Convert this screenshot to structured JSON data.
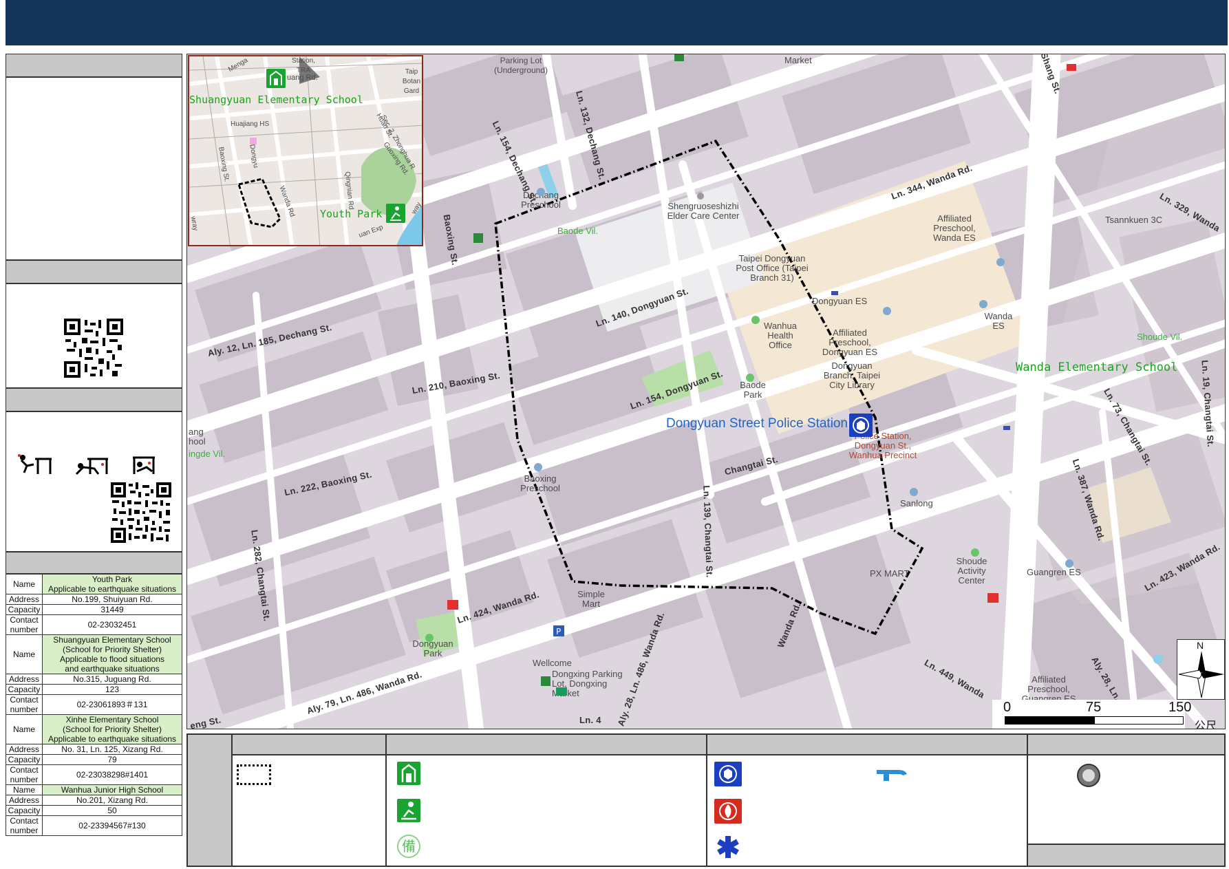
{
  "map": {
    "highlight_label": "Dongyuan Street Police Station",
    "green_labels": [
      "Shuangyuan Elementary School",
      "Youth Park",
      "Wanda Elementary School"
    ],
    "villages": [
      "Baode Vil.",
      "Shoude Vil.",
      "ingde Vil."
    ],
    "places": [
      "Market",
      "Parking Lot (Underground)",
      "Dechang Preschool",
      "Shengruoseshizhi Elder Care Center",
      "Affiliated Preschool, Wanda ES",
      "Tsannkuen 3C",
      "Taipei Dongyuan Post Office (Taipei Branch 31)",
      "Dongyuan ES",
      "Wanda ES",
      "Wanhua Health Office",
      "Affiliated Preschool, Dongyuan ES",
      "Dongyuan Branch, Taipei City Library",
      "Baode Park",
      "Police Station, Dongyuan St., Wanhua Precinct",
      "Baoxing Preschool",
      "Sanlong",
      "PX MART",
      "Shoude Activity Center",
      "Guangren ES",
      "Simple Mart",
      "Dongyuan Park",
      "Wellcome",
      "Dongxing Parking Lot, Dongxing Market",
      "Affiliated Preschool, Guangren ES",
      "ang hool"
    ],
    "roads": [
      "Ln. 132, Dechang St.",
      "Ln. 154, Dechang St.",
      "Ln. 344, Wanda Rd.",
      "Ln. 329, Wanda",
      "Baoxing St.",
      "Ln. 140, Dongyuan St.",
      "Aly. 12, Ln. 185, Dechang St.",
      "Ln. 210, Baoxing St.",
      "Ln. 154, Dongyuan St.",
      "Ln. 222, Baoxing St.",
      "Changtai St.",
      "Ln. 139, Changtai St.",
      "Ln. 282, Changtai St.",
      "Ln. 424, Wanda Rd.",
      "Aly. 28, Ln. 486, Wanda Rd.",
      "Wanda Rd.",
      "Aly. 79, Ln. 486, Wanda Rd.",
      "Ln. 449, Wanda",
      "Ln. 423, Wanda Rd.",
      "Ln. 387, Wanda Rd.",
      "Ln. 73, Changtai St.",
      "Ln. 19, Changtai St.",
      "Aly. 28, Ln.",
      "Ln. 4",
      "eng St.",
      "Changtai St.",
      "Shang St."
    ],
    "inset": {
      "labels": [
        "Station, TRA",
        "uang Rd.",
        "Taip Botan Gard",
        "Shuangyuan Elementary School",
        "Huajiang HS",
        "Huan St.",
        "Sec. 2, Zhonghua R",
        "Guoxing Rd.",
        "Baoxing St.",
        "Dongyu",
        "Wanda Rd",
        "Qingnian Rd",
        "Youth Park",
        "uan Exp",
        "way",
        "Menga",
        "wray"
      ]
    },
    "scale": {
      "ticks": [
        "0",
        "75",
        "150"
      ],
      "unit": "公尺"
    },
    "north": "N"
  },
  "shelters": [
    {
      "name": "Youth Park\nApplicable to earthquake situations",
      "address": "No.199, Shuiyuan Rd.",
      "capacity": "31449",
      "contact": "02-23032451"
    },
    {
      "name": "Shuangyuan Elementary School\n(School for Priority Shelter)\nApplicable to flood situations\nand earthquake situations",
      "address": "No.315, Juguang Rd.",
      "capacity": "123",
      "contact": "02-23061893＃131"
    },
    {
      "name": "Xinhe Elementary School\n(School for Priority Shelter)\nApplicable to earthquake situations",
      "address": "No. 31, Ln. 125, Xizang Rd.",
      "capacity": "79",
      "contact": "02-23038298#1401"
    },
    {
      "name": "Wanhua Junior High School",
      "address": "No.201, Xizang Rd.",
      "capacity": "50",
      "contact": "02-23394567#130"
    }
  ],
  "table_keys": {
    "name": "Name",
    "address": "Address",
    "capacity": "Capacity",
    "contact": "Contact\nnumber"
  },
  "legend_glyph": "備",
  "colors": {
    "header": "#14355a",
    "shelter_green": "#1aa51a",
    "police_blue": "#1b3fbf",
    "fire_red": "#d42b1e",
    "boundary": "#000000"
  }
}
